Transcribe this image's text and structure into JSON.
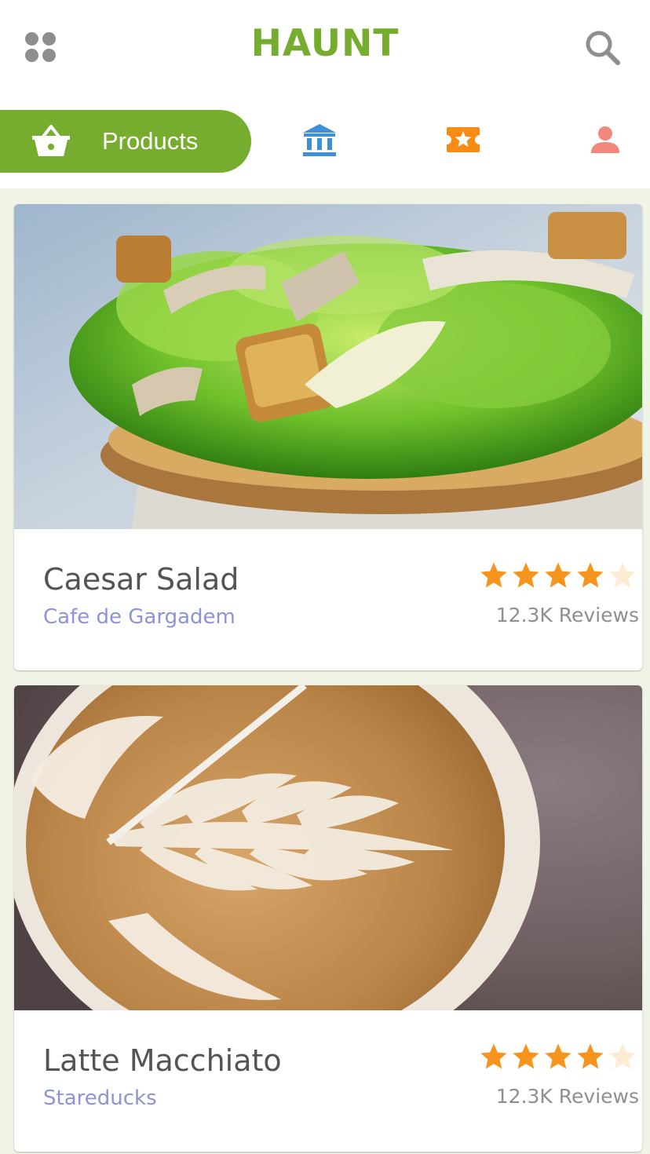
{
  "header": {
    "title": "HAUNT",
    "menu_icon": "grid-dots-icon",
    "search_icon": "search-icon"
  },
  "colors": {
    "brand_green": "#77ad2f",
    "blue": "#3d8fd6",
    "orange": "#f78b14",
    "salmon": "#f2887c",
    "star": "#f7941d",
    "star_empty": "#fdebd3",
    "vendor": "#8c93d6",
    "feed_bg": "#eff4e6"
  },
  "tabs": [
    {
      "label": "Products",
      "icon": "shopping-basket-icon",
      "active": true
    },
    {
      "icon": "bank-icon",
      "active": false
    },
    {
      "icon": "ticket-star-icon",
      "active": false
    },
    {
      "icon": "user-icon",
      "active": false
    }
  ],
  "products": [
    {
      "name": "Caesar Salad",
      "vendor": "Cafe de Gargadem",
      "rating": 4,
      "max_rating": 5,
      "reviews": "12.3K Reviews",
      "image": "caesar-salad-photo"
    },
    {
      "name": "Latte Macchiato",
      "vendor": "Stareducks",
      "rating": 4,
      "max_rating": 5,
      "reviews": "12.3K Reviews",
      "image": "latte-art-photo"
    }
  ]
}
